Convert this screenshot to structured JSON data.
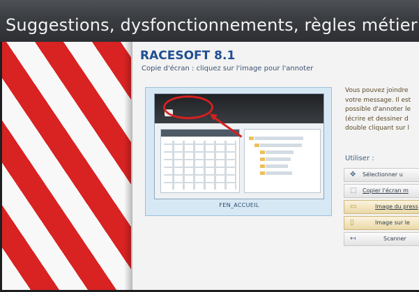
{
  "window": {
    "title": "Suggestions, dysfonctionnements, règles métier ."
  },
  "app": {
    "name": "RACESOFT 8.1",
    "subtitle": "Copie d'écran : cliquez sur l'image pour l'annoter"
  },
  "screenshot": {
    "caption": "FEN_ACCUEIL"
  },
  "info_lines": [
    "Vous pouvez joindre",
    "votre message. Il est",
    "possible d'annoter le",
    "(écrire et dessiner d",
    "double cliquant sur l"
  ],
  "use": {
    "label": "Utiliser :"
  },
  "actions": [
    {
      "label": "Sélectionner u",
      "icon": "select-icon"
    },
    {
      "label": "Copier l'écran m",
      "icon": "copy-screen-icon"
    },
    {
      "label": "Image du press",
      "icon": "clipboard-image-icon"
    },
    {
      "label": "Image sur le",
      "icon": "image-file-icon"
    },
    {
      "label": "Scanner",
      "icon": "scanner-icon"
    }
  ],
  "colors": {
    "title_bar": "#3b3e42",
    "stripe_red": "#d92222",
    "accent_blue": "#1f4f8f",
    "annotation_red": "#d62020"
  }
}
